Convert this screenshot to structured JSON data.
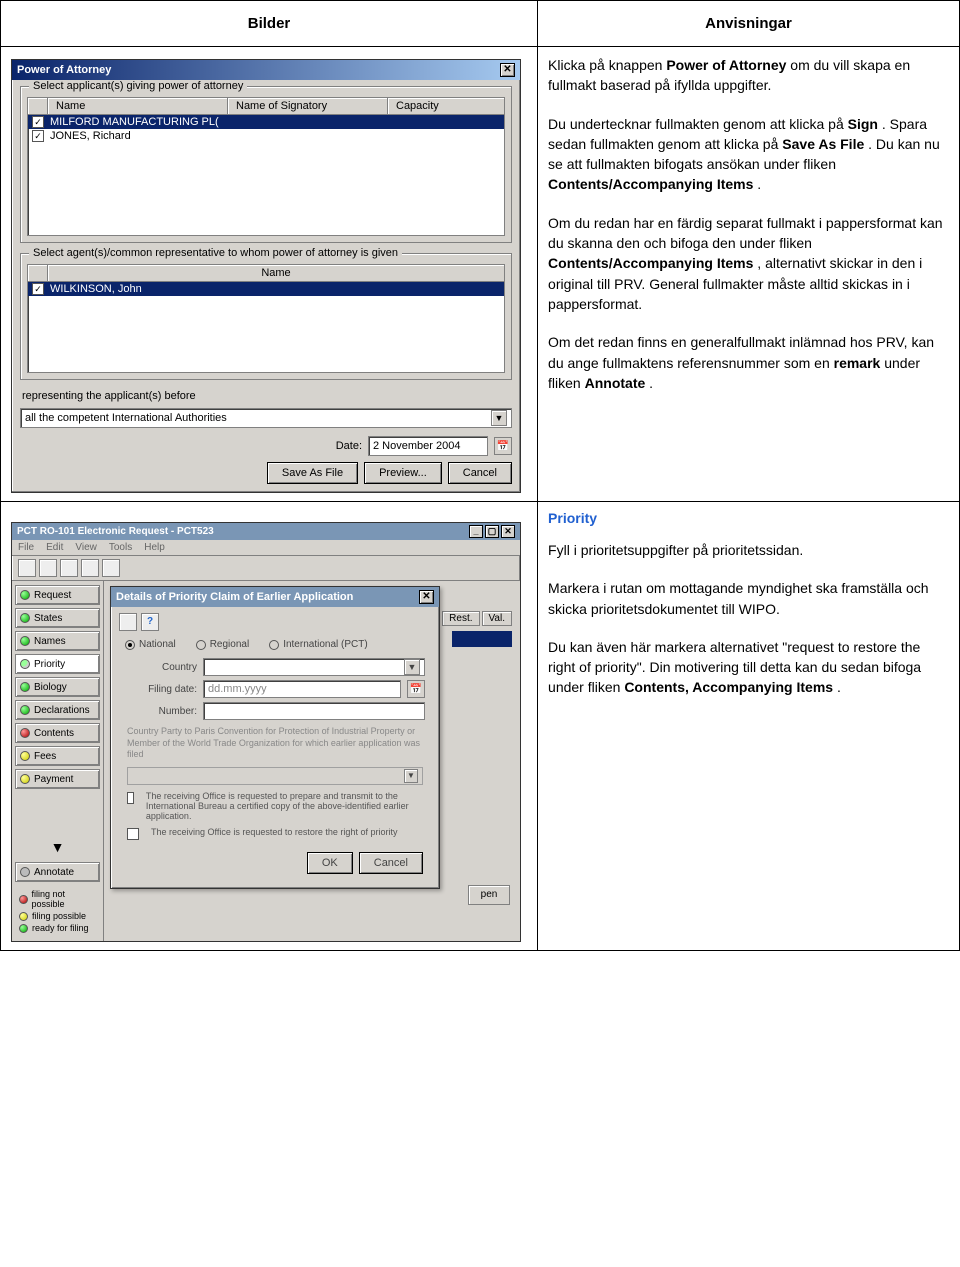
{
  "headers": {
    "bilder": "Bilder",
    "anvisningar": "Anvisningar"
  },
  "poa": {
    "title": "Power of Attorney",
    "group1_legend": "Select applicant(s) giving power of attorney",
    "col_name": "Name",
    "col_sig": "Name of Signatory",
    "col_cap": "Capacity",
    "row1": "MILFORD MANUFACTURING PL(",
    "row2": "JONES, Richard",
    "group2_legend": "Select agent(s)/common representative to whom power of attorney is given",
    "col2_name": "Name",
    "row2_1": "WILKINSON, John",
    "rep_label": "representing the applicant(s) before",
    "rep_val": "all the competent International Authorities",
    "date_label": "Date:",
    "date_val": "2 November 2004",
    "btn_save": "Save As File",
    "btn_prev": "Preview...",
    "btn_cancel": "Cancel"
  },
  "anv1": {
    "p1a": "Klicka på knappen ",
    "p1b": "Power of Attorney",
    "p1c": " om du vill skapa en fullmakt baserad på ifyllda uppgifter.",
    "p2a": "Du undertecknar fullmakten genom att klicka på ",
    "p2b": "Sign",
    "p2c": ". Spara sedan fullmakten genom att klicka på ",
    "p2d": "Save As File",
    "p2e": ". Du kan nu se att fullmakten bifogats ansökan under fliken ",
    "p2f": "Contents/Accompanying Items",
    "p2g": ".",
    "p3a": "Om du redan har en färdig separat fullmakt i pappersformat kan du skanna den och bifoga den under fliken ",
    "p3b": "Contents/Accompanying Items",
    "p3c": ", alternativt skickar in den i original till PRV. General fullmakter måste alltid skickas in i pappersformat.",
    "p4a": "Om det redan finns en generalfullmakt inlämnad hos PRV, kan du ange fullmaktens referensnummer som en ",
    "p4b": "remark",
    "p4c": " under fliken ",
    "p4d": "Annotate",
    "p4e": "."
  },
  "pct": {
    "title": "PCT RO-101 Electronic Request - PCT523",
    "menu": {
      "file": "File",
      "edit": "Edit",
      "view": "View",
      "tools": "Tools",
      "help": "Help"
    },
    "side": {
      "request": "Request",
      "states": "States",
      "names": "Names",
      "priority": "Priority",
      "biology": "Biology",
      "decl": "Declarations",
      "contents": "Contents",
      "fees": "Fees",
      "payment": "Payment",
      "annotate": "Annotate"
    },
    "legend": {
      "np": "filing not possible",
      "fp": "filing possible",
      "rf": "ready for filing"
    },
    "cols": {
      "rest": "Rest.",
      "val": "Val."
    },
    "open": "pen"
  },
  "prio_dlg": {
    "title": "Details of Priority Claim of Earlier Application",
    "r_nat": "National",
    "r_reg": "Regional",
    "r_int": "International (PCT)",
    "country": "Country",
    "filing": "Filing date:",
    "filing_ph": "dd.mm.yyyy",
    "number": "Number:",
    "hint": "Country Party to Paris Convention for Protection of Industrial Property or Member of the World Trade Organization for which earlier application was filed",
    "chk1": "The receiving Office is requested to prepare and transmit to the International Bureau a certified copy of the above-identified earlier application.",
    "chk2": "The receiving Office is requested to restore the right of priority",
    "ok": "OK",
    "cancel": "Cancel"
  },
  "anv2": {
    "title": "Priority",
    "p1": "Fyll i prioritetsuppgifter på prioritetssidan.",
    "p2": "Markera i rutan om mottagande myndighet ska framställa och skicka prioritetsdokumentet till WIPO.",
    "p3a": "Du kan även här markera alternativet \"request to restore the right of priority\". Din motivering till detta kan du sedan bifoga under fliken ",
    "p3b": "Contents, Accompanying Items",
    "p3c": "."
  }
}
